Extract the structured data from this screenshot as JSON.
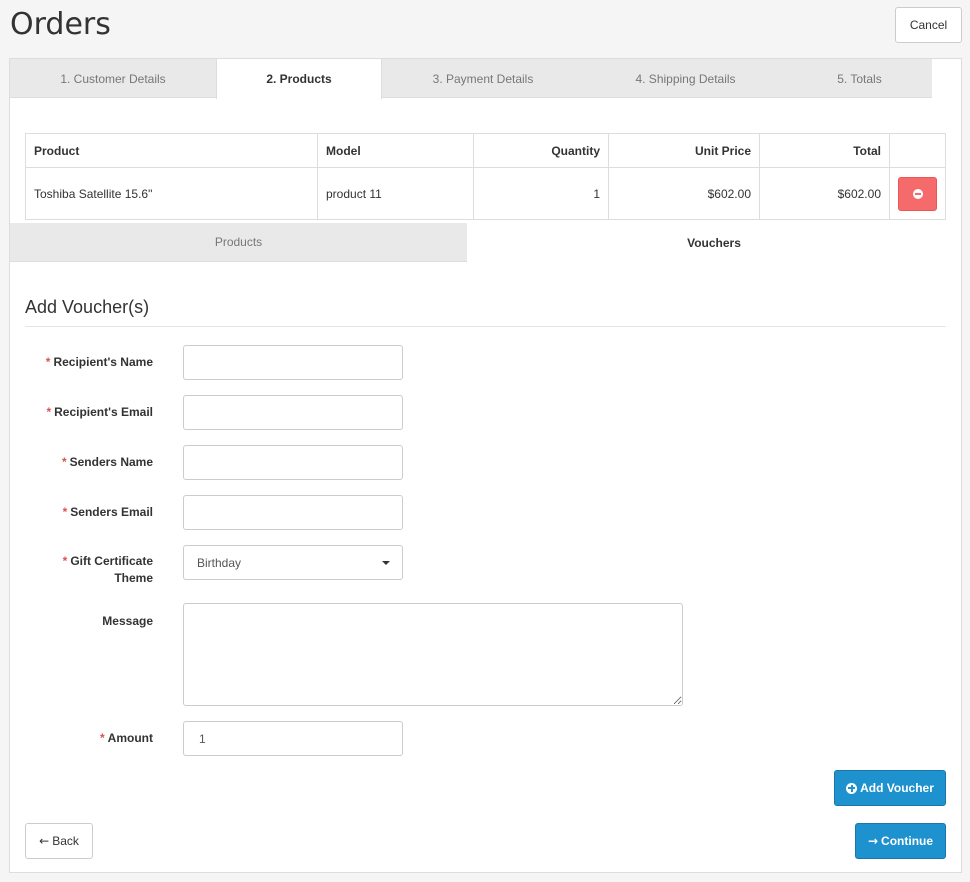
{
  "header": {
    "title": "Orders",
    "cancel_label": "Cancel"
  },
  "steps": [
    {
      "label": "1. Customer Details",
      "active": false
    },
    {
      "label": "2. Products",
      "active": true
    },
    {
      "label": "3. Payment Details",
      "active": false
    },
    {
      "label": "4. Shipping Details",
      "active": false
    },
    {
      "label": "5. Totals",
      "active": false
    }
  ],
  "products_table": {
    "columns": {
      "product": "Product",
      "model": "Model",
      "quantity": "Quantity",
      "unit_price": "Unit Price",
      "total": "Total"
    },
    "rows": [
      {
        "product": "Toshiba Satellite 15.6\"",
        "model": "product 11",
        "quantity": "1",
        "unit_price": "$602.00",
        "total": "$602.00"
      }
    ]
  },
  "sub_tabs": {
    "products": "Products",
    "vouchers": "Vouchers",
    "active": "vouchers"
  },
  "voucher_form": {
    "legend": "Add Voucher(s)",
    "required_mark": "*",
    "recipient_name_label": "Recipient's Name",
    "recipient_name_value": "",
    "recipient_email_label": "Recipient's Email",
    "recipient_email_value": "",
    "sender_name_label": "Senders Name",
    "sender_name_value": "",
    "sender_email_label": "Senders Email",
    "sender_email_value": "",
    "theme_label_line1": "Gift Certificate",
    "theme_label_line2": "Theme",
    "theme_value": "Birthday",
    "message_label": "Message",
    "message_value": "",
    "amount_label": "Amount",
    "amount_value": "1",
    "add_voucher_label": "Add Voucher"
  },
  "footer": {
    "back_label": "Back",
    "continue_label": "Continue"
  },
  "colors": {
    "primary": "#1e91cf",
    "danger": "#f56b6b",
    "required": "#d9534f"
  }
}
